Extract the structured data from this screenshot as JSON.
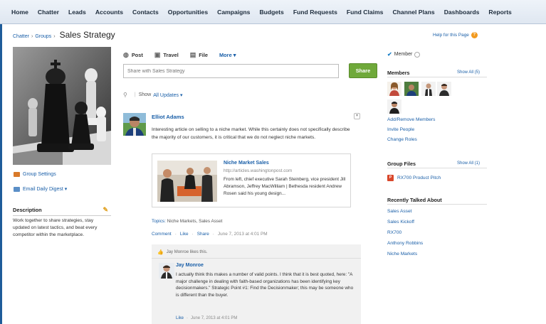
{
  "nav": {
    "tabs": [
      "Home",
      "Chatter",
      "Leads",
      "Accounts",
      "Contacts",
      "Opportunities",
      "Campaigns",
      "Budgets",
      "Fund Requests",
      "Fund Claims",
      "Channel Plans",
      "Dashboards",
      "Reports"
    ]
  },
  "breadcrumb": {
    "chatter": "Chatter",
    "groups": "Groups",
    "sep": "›",
    "title": "Sales Strategy"
  },
  "help": {
    "label": "Help for this Page",
    "q": "?"
  },
  "left": {
    "group_settings": "Group Settings",
    "email_digest": "Email Daily Digest ▾",
    "description_heading": "Description",
    "description_text": "Work together to share strategies, stay updated on latest tactics, and beat every competitor within the marketplace."
  },
  "publisher": {
    "tabs": [
      {
        "label": "Post",
        "icon": "post-icon"
      },
      {
        "label": "Travel",
        "icon": "travel-icon"
      },
      {
        "label": "File",
        "icon": "file-icon"
      },
      {
        "label": "More ▾",
        "icon": ""
      }
    ],
    "placeholder": "Share with Sales Strategy",
    "share_label": "Share"
  },
  "filter": {
    "show": "Show",
    "value": "All Updates ▾"
  },
  "post": {
    "author": "Elliot Adams",
    "text": "Interesting article on selling to a niche market. While this certainly does not specifically describe the majority of our customers, it is critical that we do not neglect niche markets.",
    "link": {
      "title": "Niche Market Sales",
      "url": "http://articles.washingtonpost.com",
      "desc": "From left, chief executive Sarah Steinberg, vice president Jill Abramson, Jeffrey MacWilliam | Bethesda resident Andrew Rosen said his young design..."
    },
    "topics_label": "Topics:",
    "topics": "Niche Markets, Sales Asset",
    "actions": {
      "comment": "Comment",
      "like": "Like",
      "share": "Share",
      "timestamp": "June 7, 2013 at 4:01 PM"
    }
  },
  "comment": {
    "likes": "Jay Monroe likes this.",
    "author": "Jay Monroe",
    "text": "I actually think this makes a number of valid points. I think that it is best quoted, here: \"A major challenge in dealing with faith-based organizations has been identifying key decisionmakers.\" Strategic Point #1: Find the Decisionmaker; this may be someone who is different than the buyer.",
    "like": "Like",
    "timestamp": "June 7, 2013 at 4:01 PM"
  },
  "right": {
    "member_label": "Member",
    "members_heading": "Members",
    "members_showall": "Show All (5)",
    "member_links": [
      "Add/Remove Members",
      "Invite People",
      "Change Roles"
    ],
    "files_heading": "Group Files",
    "files_showall": "Show All (1)",
    "file": "RX700 Product Pitch",
    "recent_heading": "Recently Talked About",
    "recent": [
      "Sales Asset",
      "Sales Kickoff",
      "RX700",
      "Anthony Robbins",
      "Niche Markets"
    ]
  },
  "colors": {
    "accent": "#1a5fa8",
    "share_button": "#6fa93a",
    "nav_bg": "#e6edf5",
    "help_icon": "#f29a1f"
  }
}
